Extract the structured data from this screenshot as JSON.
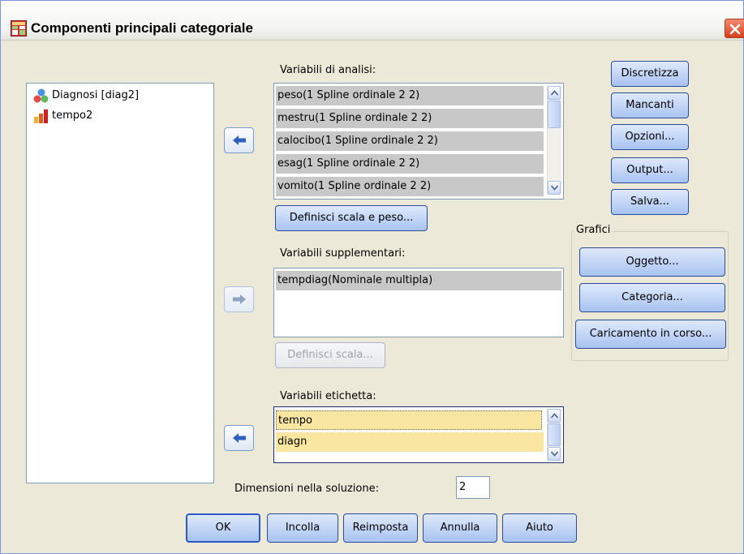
{
  "window": {
    "title": "Componenti principali categoriale"
  },
  "source_list": {
    "items": [
      {
        "label": "Diagnosi [diag2]",
        "icon": "nominal-icon"
      },
      {
        "label": "tempo2",
        "icon": "scale-icon"
      }
    ]
  },
  "analysis": {
    "label": "Variabili di analisi:",
    "items": [
      "peso(1 Spline ordinale 2 2)",
      "mestru(1 Spline ordinale 2 2)",
      "calocibo(1 Spline ordinale 2 2)",
      "esag(1 Spline ordinale 2 2)",
      "vomito(1 Spline ordinale 2 2)"
    ],
    "define_button": "Definisci scala e peso..."
  },
  "supplementary": {
    "label": "Variabili supplementari:",
    "items": [
      "tempdiag(Nominale multipla)"
    ],
    "define_button": "Definisci scala..."
  },
  "labels": {
    "label": "Variabili etichetta:",
    "items": [
      "tempo",
      "diagn"
    ]
  },
  "dimensions": {
    "label": "Dimensioni nella soluzione:",
    "value": "2"
  },
  "side_buttons": [
    "Discretizza",
    "Mancanti",
    "Opzioni...",
    "Output...",
    "Salva..."
  ],
  "plots": {
    "group_label": "Grafici",
    "buttons": [
      "Oggetto...",
      "Categoria...",
      "Caricamento in corso..."
    ]
  },
  "footer_buttons": [
    "OK",
    "Incolla",
    "Reimposta",
    "Annulla",
    "Aiuto"
  ],
  "colors": {
    "dialog_bg": "#ece9d8",
    "selected_gray": "#c8c8c8",
    "selected_yellow": "#f9e6a0",
    "accent_blue": "#1f4fbf"
  }
}
